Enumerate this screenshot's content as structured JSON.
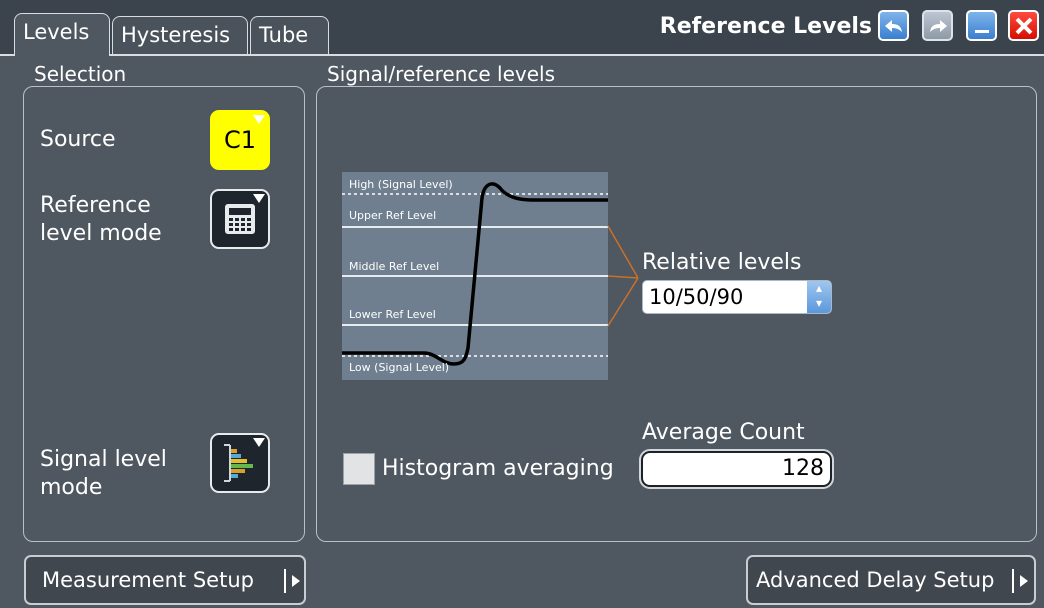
{
  "tabs": [
    {
      "label": "Levels",
      "active": true
    },
    {
      "label": "Hysteresis",
      "active": false
    },
    {
      "label": "Tube",
      "active": false
    }
  ],
  "window": {
    "title": "Reference Levels",
    "buttons": [
      "undo-icon",
      "redo-icon",
      "minimize-icon",
      "close-icon"
    ]
  },
  "selection": {
    "title": "Selection",
    "source_label": "Source",
    "source_value": "C1",
    "ref_mode_label": "Reference\nlevel mode",
    "signal_mode_label": "Signal level\nmode"
  },
  "levels": {
    "title": "Signal/reference levels",
    "diagram": {
      "high": "High (Signal Level)",
      "upper": "Upper Ref Level",
      "middle": "Middle Ref Level",
      "lower": "Lower Ref Level",
      "low": "Low (Signal Level)"
    },
    "relative_label": "Relative levels",
    "relative_value": "10/50/90",
    "histogram_label": "Histogram averaging",
    "histogram_checked": false,
    "avg_label": "Average Count",
    "avg_value": "128"
  },
  "footer": {
    "measurement_setup": "Measurement Setup",
    "advanced_delay_setup": "Advanced Delay Setup"
  },
  "colors": {
    "background": "#4f5760",
    "source_button": "#ffff00",
    "close_button": "#d40e00",
    "accent_blue": "#3a7fd0",
    "diagram_bg": "#6f7f8f",
    "bracket": "#c9712a"
  }
}
